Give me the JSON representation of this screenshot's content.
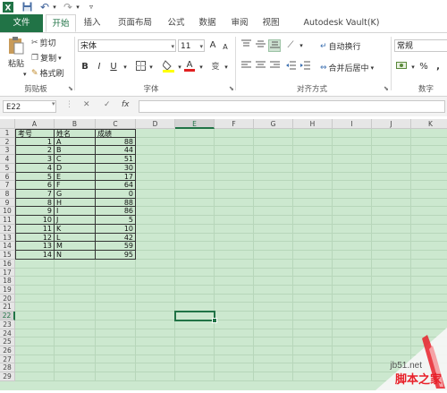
{
  "quick_access": {
    "app_icon": "excel-icon",
    "save_icon": "save-icon",
    "undo_glyph": "↶",
    "redo_glyph": "↷",
    "dropdown_glyph": "▾"
  },
  "tabs": [
    {
      "label": "文件",
      "name": "tab-file"
    },
    {
      "label": "开始",
      "name": "tab-home"
    },
    {
      "label": "插入",
      "name": "tab-insert"
    },
    {
      "label": "页面布局",
      "name": "tab-page-layout"
    },
    {
      "label": "公式",
      "name": "tab-formulas"
    },
    {
      "label": "数据",
      "name": "tab-data"
    },
    {
      "label": "审阅",
      "name": "tab-review"
    },
    {
      "label": "视图",
      "name": "tab-view"
    },
    {
      "label": "Autodesk Vault(K)",
      "name": "tab-autodesk-vault"
    }
  ],
  "ribbon": {
    "clipboard": {
      "paste": "粘贴",
      "cut": "剪切",
      "copy": "复制",
      "format_painter": "格式刷",
      "group_label": "剪贴板"
    },
    "font": {
      "font_name": "宋体",
      "font_size": "11",
      "grow": "A",
      "shrink": "A",
      "bold": "B",
      "italic": "I",
      "underline": "U",
      "strikethrough": "变",
      "group_label": "字体",
      "highlight_color": "#ffff00",
      "font_color": "#e02020"
    },
    "alignment": {
      "wrap_text": "自动换行",
      "merge_center": "合并后居中",
      "group_label": "对齐方式"
    },
    "number": {
      "format": "常规",
      "percent": "%",
      "comma": ",",
      "group_label": "数字"
    }
  },
  "formula_bar": {
    "name_box": "E22",
    "cancel": "✕",
    "enter": "✓",
    "fx": "fx",
    "formula": ""
  },
  "sheet": {
    "columns": [
      "A",
      "B",
      "C",
      "D",
      "E",
      "F",
      "G",
      "H",
      "I",
      "J",
      "K"
    ],
    "rows": [
      "1",
      "2",
      "3",
      "4",
      "5",
      "6",
      "7",
      "8",
      "9",
      "10",
      "11",
      "12",
      "13",
      "14",
      "15",
      "16",
      "17",
      "18",
      "19",
      "20",
      "21",
      "22",
      "23",
      "24",
      "25",
      "26",
      "27",
      "28",
      "29"
    ],
    "headers": [
      "考号",
      "姓名",
      "成绩"
    ],
    "data": [
      [
        1,
        "A",
        88
      ],
      [
        2,
        "B",
        44
      ],
      [
        3,
        "C",
        51
      ],
      [
        4,
        "D",
        30
      ],
      [
        5,
        "E",
        17
      ],
      [
        6,
        "F",
        64
      ],
      [
        7,
        "G",
        0
      ],
      [
        8,
        "H",
        88
      ],
      [
        9,
        "I",
        86
      ],
      [
        10,
        "J",
        5
      ],
      [
        11,
        "K",
        10
      ],
      [
        12,
        "L",
        42
      ],
      [
        13,
        "M",
        59
      ],
      [
        14,
        "N",
        95
      ]
    ],
    "active_cell": "E22"
  },
  "watermark": {
    "line1": "jb51.net",
    "line2": "脚本之家",
    "accent": "#e8212a"
  },
  "colors": {
    "excel_green": "#217346",
    "sheet_bg": "#cce8cf"
  }
}
